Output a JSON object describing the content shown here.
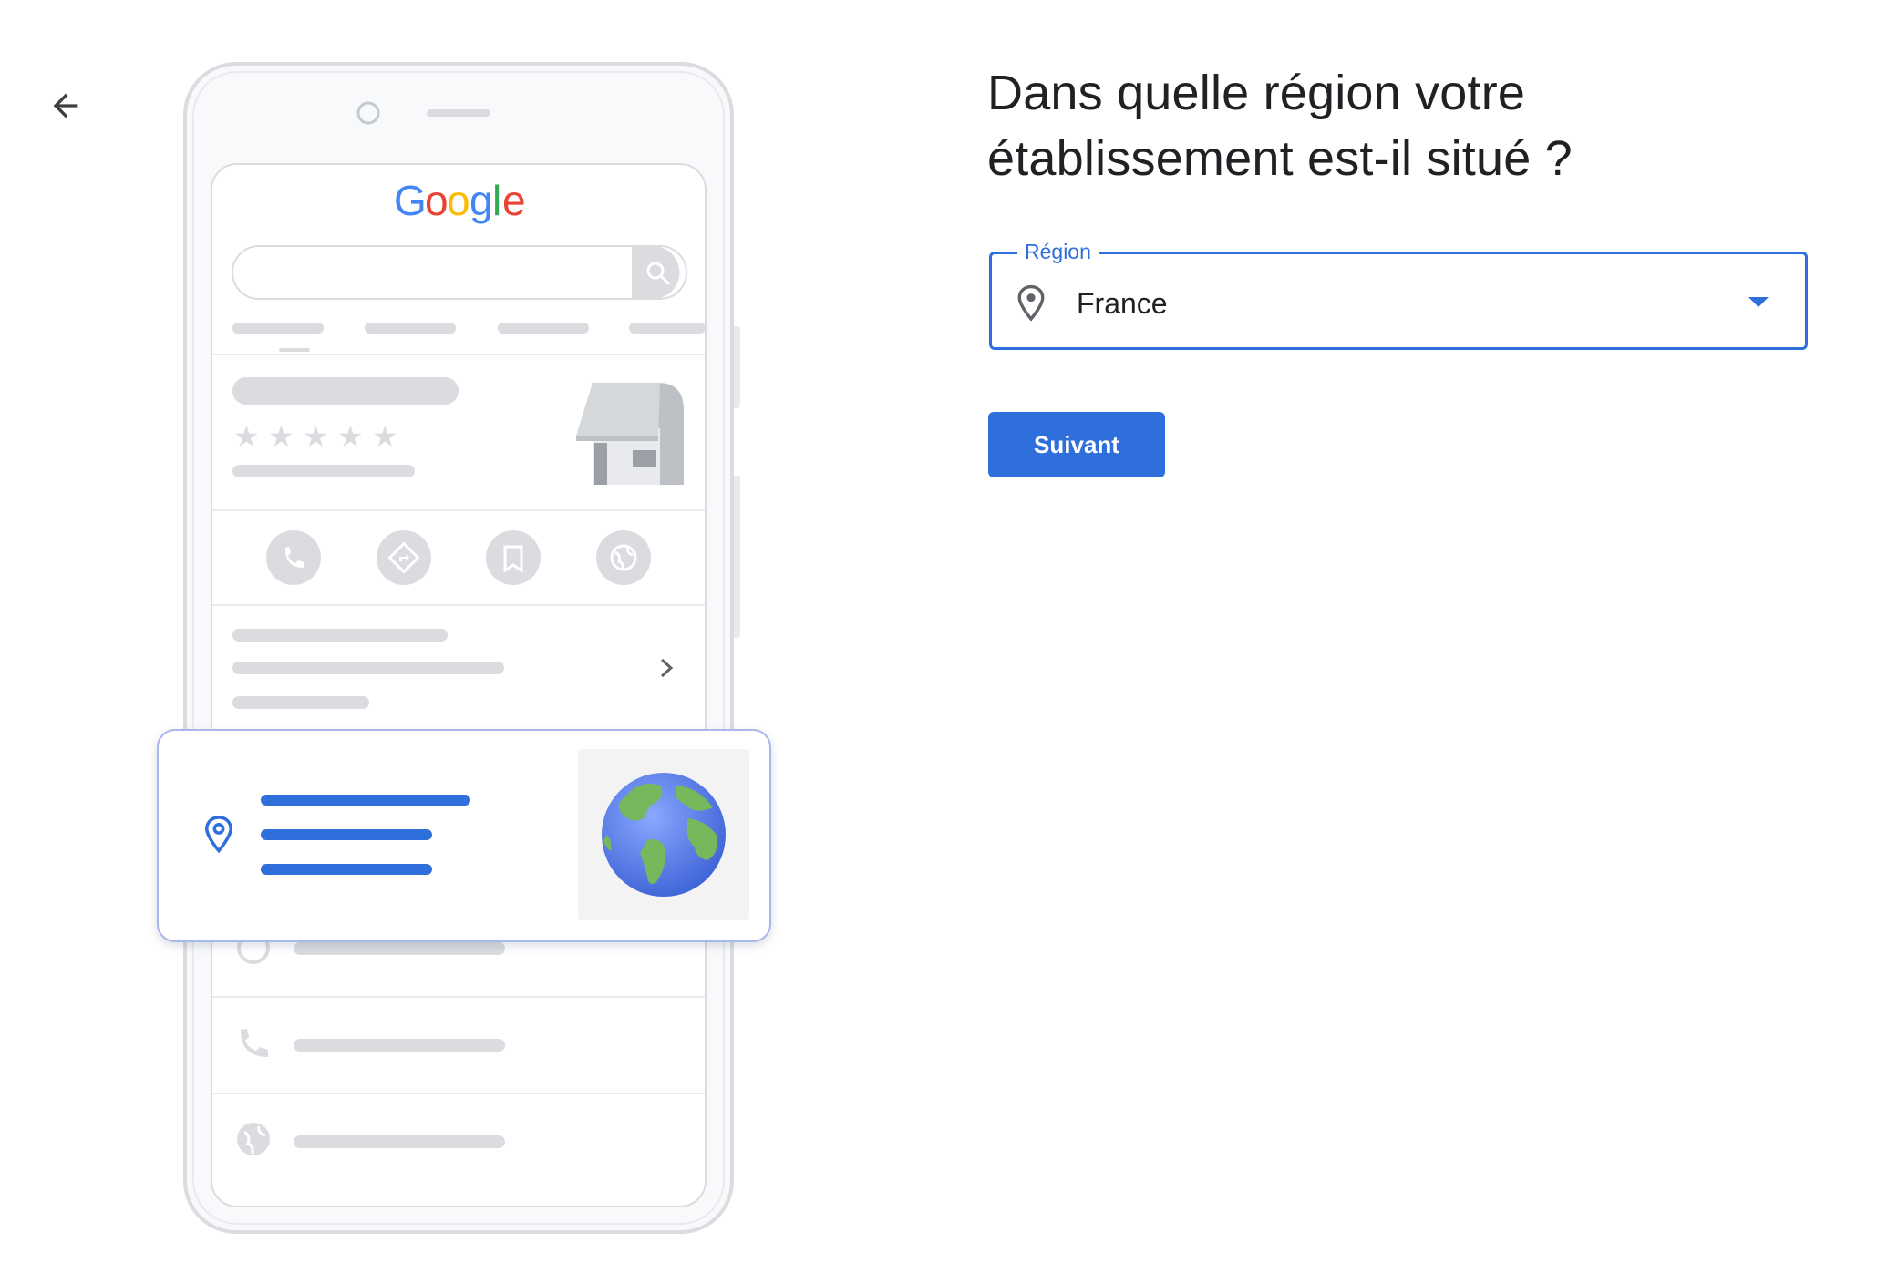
{
  "header": {
    "back_icon": "arrow-back-icon"
  },
  "illustration": {
    "logo_text": "Google",
    "logo_colors": [
      "#4285F4",
      "#EA4335",
      "#FBBC05",
      "#4285F4",
      "#34A853",
      "#EA4335"
    ],
    "icons": [
      "search-icon",
      "phone-icon",
      "directions-icon",
      "bookmark-icon",
      "globe-icon",
      "chevron-right-icon",
      "clock-icon",
      "storefront-icon",
      "location-pin-icon"
    ]
  },
  "main": {
    "title": "Dans quelle région votre établissement est-il situé ?",
    "region_field": {
      "label": "Région",
      "value": "France",
      "icon": "location-pin-icon",
      "dropdown_icon": "dropdown-arrow-icon"
    },
    "next_button_label": "Suivant"
  },
  "colors": {
    "accent": "#2f6fdc",
    "text": "#202124",
    "placeholder_gray": "#dadce0",
    "icon_gray": "#9aa0a6"
  }
}
